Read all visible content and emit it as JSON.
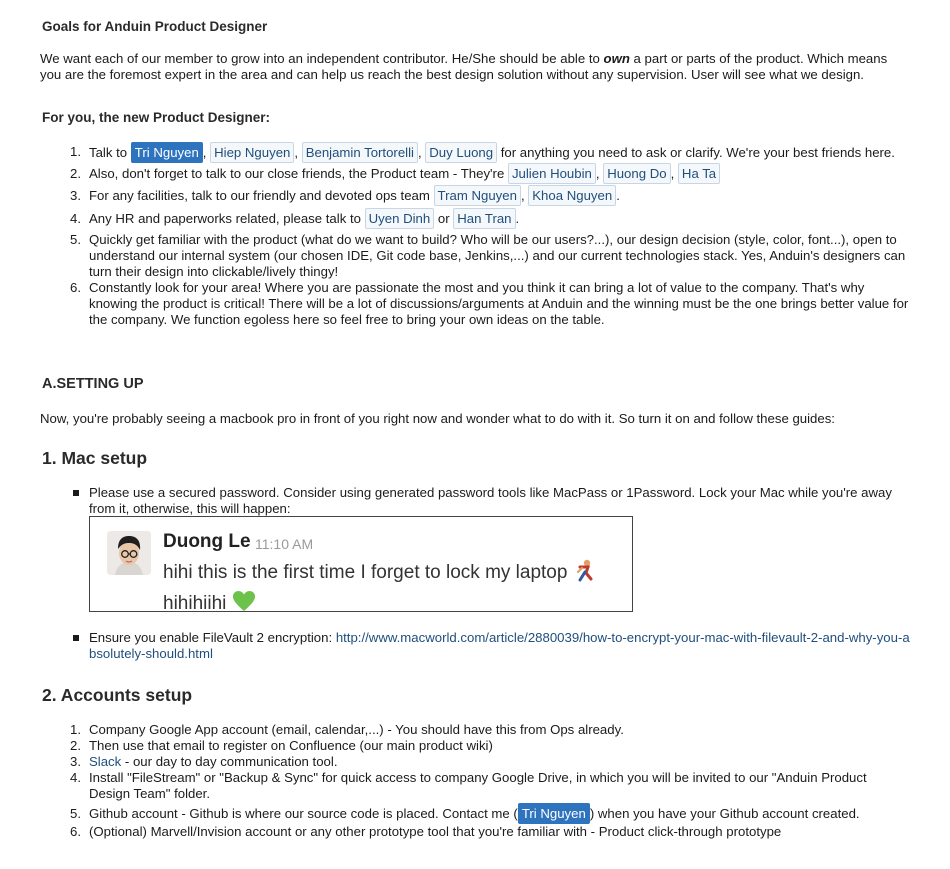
{
  "goals": {
    "title": "Goals for Anduin Product Designer",
    "intro_before": "We want each of our member to grow into an independent contributor. He/She should be able to ",
    "intro_em": "own",
    "intro_after": " a part or parts of the product. Which means you are the foremost expert in the area and can help us reach the best design solution without any supervision. User will see what we design."
  },
  "for_you": {
    "title": "For you, the new Product Designer:",
    "items": [
      {
        "num": "1.",
        "before": "Talk to ",
        "mentions": [
          "Tri Nguyen",
          "Hiep Nguyen",
          "Benjamin Tortorelli",
          "Duy Luong"
        ],
        "after": " for anything you need to ask or clarify. We're your best friends here."
      },
      {
        "num": "2.",
        "before": "Also, don't forget to talk to our close friends, the Product team - They're ",
        "mentions": [
          "Julien Houbin",
          "Huong Do",
          "Ha Ta"
        ],
        "after": ""
      },
      {
        "num": "3.",
        "before": "For any facilities, talk to our friendly and devoted ops team ",
        "mentions": [
          "Tram Nguyen",
          "Khoa Nguyen"
        ],
        "after": "."
      },
      {
        "num": "4.",
        "before": "Any HR and paperworks related, please talk to ",
        "mentions": [
          "Uyen Dinh",
          "Han Tran"
        ],
        "joiner": " or ",
        "after": "."
      },
      {
        "num": "5.",
        "text": "Quickly get familiar with the product (what do we want to build? Who will be our users?...), our design decision (style, color, font...), open to understand our internal system (our chosen IDE, Git code base, Jenkins,...) and our current technologies stack. Yes, Anduin's designers can turn their design into clickable/lively thingy!"
      },
      {
        "num": "6.",
        "text": "Constantly look for your area! Where you are passionate the most and you think it can bring a lot of value to the company. That's why knowing the product is critical! There will be a lot of discussions/arguments at Anduin and the winning must be the one brings better value for the company. We function egoless here so feel free to bring your own ideas on the table."
      }
    ]
  },
  "setting_up": {
    "title": "A.SETTING UP",
    "intro": "Now, you're probably seeing a macbook pro in front of you right now and wonder what to do with it. So turn it on and follow these guides:"
  },
  "mac_setup": {
    "title": "1. Mac setup",
    "bullet1": "Please use a secured password. Consider using generated password tools like MacPass or 1Password. Lock your Mac while you're away from it, otherwise, this will happen:",
    "slack": {
      "name": "Duong Le",
      "time": "11:10 AM",
      "message": "hihi this is the first time I forget to lock my laptop",
      "message2": "hihihiihi"
    },
    "bullet2_text": "Ensure you enable FileVault 2 encryption: ",
    "bullet2_link": "http://www.macworld.com/article/2880039/how-to-encrypt-your-mac-with-filevault-2-and-why-you-absolutely-should.html"
  },
  "accounts": {
    "title": "2. Accounts setup",
    "item1": "Company Google App account (email, calendar,...) - You should have this from Ops already.",
    "item2": "Then use that email to register on Confluence (our main product wiki)",
    "item3_link": "Slack",
    "item3_rest": " - our day to day communication tool.",
    "item4": "Install \"FileStream\" or \"Backup & Sync\" for quick access to company Google Drive, in which you will be invited to our \"Anduin Product Design Team\" folder.",
    "item5_before": "Github account - Github is where our source code is placed. Contact me (",
    "item5_mention": "Tri Nguyen",
    "item5_after": ") when you have your Github account created.",
    "item6": "(Optional) Marvell/Invision account or any other prototype tool that you're familiar with - Product click-through prototype",
    "nums": [
      "1.",
      "2.",
      "3.",
      "4.",
      "5.",
      "6."
    ]
  }
}
